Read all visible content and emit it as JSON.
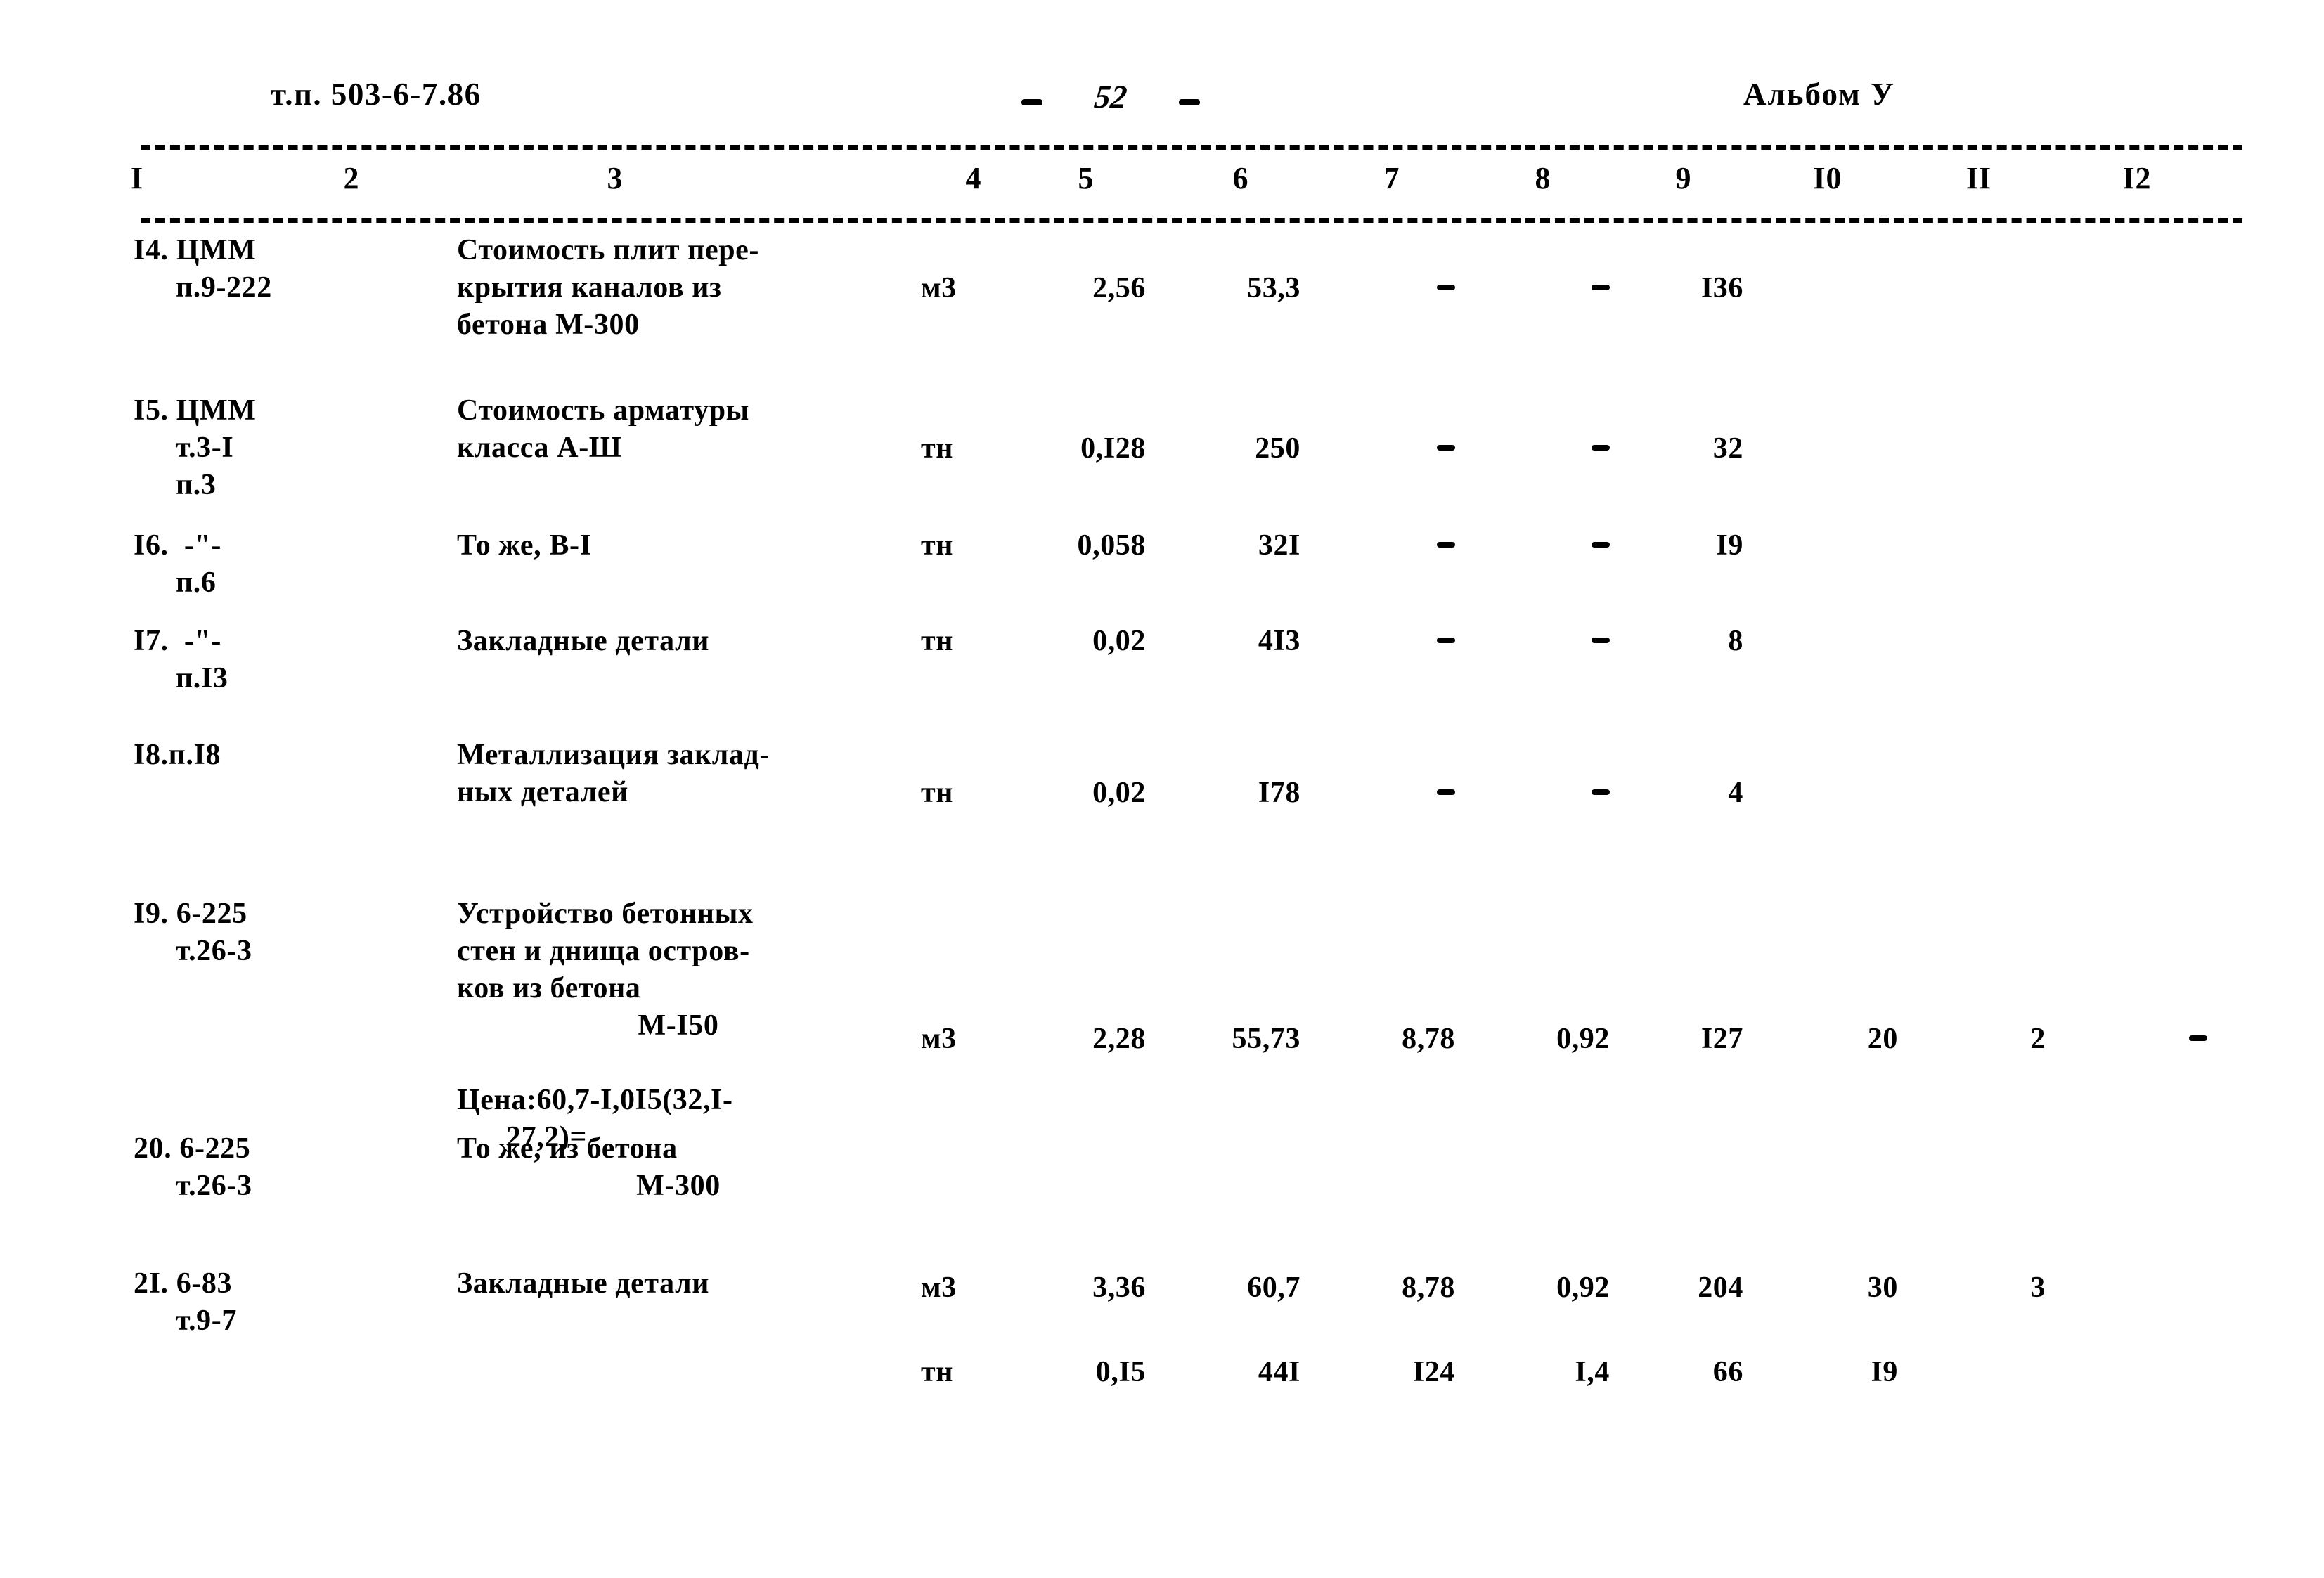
{
  "header": {
    "doc_code": "т.п. 503-6-7.86",
    "page_number": "52",
    "album": "Альбом У"
  },
  "table": {
    "column_numbers": [
      "I",
      "2",
      "3",
      "4",
      "5",
      "6",
      "7",
      "8",
      "9",
      "I0",
      "II",
      "I2"
    ],
    "rows": [
      {
        "id": "row-14",
        "code_lines": [
          "I4. ЦММ",
          "п.9-222"
        ],
        "description_lines": [
          "Стоимость плит пере-",
          "крытия каналов из",
          "бетона М-300"
        ],
        "unit": "м3",
        "c5": "2,56",
        "c6": "53,3",
        "c7": "-",
        "c8": "-",
        "c9": "I36",
        "c10": "",
        "c11": "",
        "c12": ""
      },
      {
        "id": "row-15",
        "code_lines": [
          "I5. ЦММ",
          "т.3-I",
          "п.3"
        ],
        "description_lines": [
          "Стоимость арматуры",
          "класса А-Ш"
        ],
        "unit": "тн",
        "c5": "0,I28",
        "c6": "250",
        "c7": "-",
        "c8": "-",
        "c9": "32",
        "c10": "",
        "c11": "",
        "c12": ""
      },
      {
        "id": "row-16",
        "code_lines": [
          "I6.  -\"-",
          "п.6"
        ],
        "description_lines": [
          "То же, В-I"
        ],
        "unit": "тн",
        "c5": "0,058",
        "c6": "32I",
        "c7": "-",
        "c8": "-",
        "c9": "I9",
        "c10": "",
        "c11": "",
        "c12": ""
      },
      {
        "id": "row-17",
        "code_lines": [
          "I7.  -\"-",
          "п.I3"
        ],
        "description_lines": [
          "Закладные детали"
        ],
        "unit": "тн",
        "c5": "0,02",
        "c6": "4I3",
        "c7": "-",
        "c8": "-",
        "c9": "8",
        "c10": "",
        "c11": "",
        "c12": ""
      },
      {
        "id": "row-18",
        "code_lines": [
          "I8.п.I8"
        ],
        "description_lines": [
          "Металлизация заклад-",
          "ных деталей"
        ],
        "unit": "тн",
        "c5": "0,02",
        "c6": "I78",
        "c7": "-",
        "c8": "-",
        "c9": "4",
        "c10": "",
        "c11": "",
        "c12": ""
      },
      {
        "id": "row-19",
        "code_lines": [
          "I9. 6-225",
          "т.26-3"
        ],
        "description_lines": [
          "Устройство бетонных",
          "стен и днища остров-",
          "ков из бетона",
          "М-I50"
        ],
        "price_lines": [
          "Цена:60,7-I,0I5(32,I-",
          "27,2)="
        ],
        "unit": "м3",
        "c5": "2,28",
        "c6": "55,73",
        "c7": "8,78",
        "c8": "0,92",
        "c9": "I27",
        "c10": "20",
        "c11": "2",
        "c12": "-"
      },
      {
        "id": "row-20",
        "code_lines": [
          "20. 6-225",
          "т.26-3"
        ],
        "description_lines": [
          "То же, из бетона",
          "М-300"
        ],
        "unit": "м3",
        "c5": "3,36",
        "c6": "60,7",
        "c7": "8,78",
        "c8": "0,92",
        "c9": "204",
        "c10": "30",
        "c11": "3",
        "c12": ""
      },
      {
        "id": "row-21",
        "code_lines": [
          "2I. 6-83",
          "т.9-7"
        ],
        "description_lines": [
          "Закладные детали"
        ],
        "unit": "тн",
        "c5": "0,I5",
        "c6": "44I",
        "c7": "I24",
        "c8": "I,4",
        "c9": "66",
        "c10": "I9",
        "c11": "",
        "c12": ""
      }
    ]
  }
}
